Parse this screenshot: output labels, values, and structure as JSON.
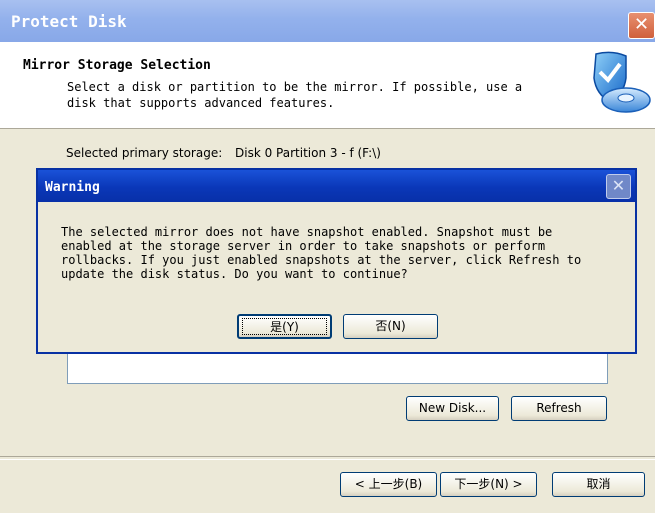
{
  "window": {
    "title": "Protect Disk",
    "close_glyph": "✕"
  },
  "header": {
    "title": "Mirror Storage Selection",
    "description": "Select a disk or partition to be the mirror. If possible, use a\ndisk that supports advanced features.",
    "logo_icon": "shield-disk-icon"
  },
  "primary_storage": {
    "label": "Selected primary storage:",
    "value": "Disk 0 Partition 3 - f (F:\\)"
  },
  "buttons": {
    "new_disk": "New Disk...",
    "refresh": "Refresh"
  },
  "footer": {
    "back": "< 上一步(B)",
    "next": "下一步(N) >",
    "cancel": "取消"
  },
  "warning": {
    "title": "Warning",
    "close_glyph": "✕",
    "message": "The selected mirror does not have snapshot enabled. Snapshot must be\nenabled at the storage server in order to take snapshots or perform\nrollbacks. If you just enabled snapshots at the server, click Refresh to\nupdate the disk status. Do you want to continue?",
    "yes": "是(Y)",
    "no": "否(N)"
  },
  "colors": {
    "titlebar_active": "#0a37b8",
    "titlebar_inactive": "#93b1ec",
    "dialog_bg": "#ece9d8"
  }
}
